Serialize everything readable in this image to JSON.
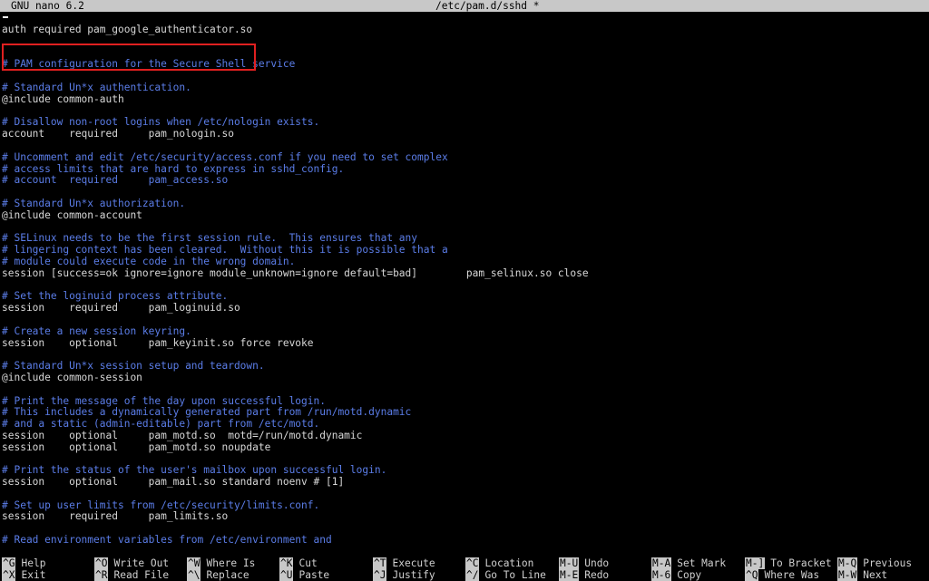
{
  "titlebar": {
    "app": "GNU nano 6.2",
    "file": "/etc/pam.d/sshd *"
  },
  "lines": [
    {
      "text": "auth required pam_google_authenticator.so",
      "type": "code"
    },
    {
      "text": "",
      "type": "code"
    },
    {
      "text": "",
      "type": "code"
    },
    {
      "text": "# PAM configuration for the Secure Shell service",
      "type": "comment"
    },
    {
      "text": "",
      "type": "code"
    },
    {
      "text": "# Standard Un*x authentication.",
      "type": "comment"
    },
    {
      "text": "@include common-auth",
      "type": "code"
    },
    {
      "text": "",
      "type": "code"
    },
    {
      "text": "# Disallow non-root logins when /etc/nologin exists.",
      "type": "comment"
    },
    {
      "text": "account    required     pam_nologin.so",
      "type": "code"
    },
    {
      "text": "",
      "type": "code"
    },
    {
      "text": "# Uncomment and edit /etc/security/access.conf if you need to set complex",
      "type": "comment"
    },
    {
      "text": "# access limits that are hard to express in sshd_config.",
      "type": "comment"
    },
    {
      "text": "# account  required     pam_access.so",
      "type": "comment"
    },
    {
      "text": "",
      "type": "code"
    },
    {
      "text": "# Standard Un*x authorization.",
      "type": "comment"
    },
    {
      "text": "@include common-account",
      "type": "code"
    },
    {
      "text": "",
      "type": "code"
    },
    {
      "text": "# SELinux needs to be the first session rule.  This ensures that any",
      "type": "comment"
    },
    {
      "text": "# lingering context has been cleared.  Without this it is possible that a",
      "type": "comment"
    },
    {
      "text": "# module could execute code in the wrong domain.",
      "type": "comment"
    },
    {
      "text": "session [success=ok ignore=ignore module_unknown=ignore default=bad]        pam_selinux.so close",
      "type": "code"
    },
    {
      "text": "",
      "type": "code"
    },
    {
      "text": "# Set the loginuid process attribute.",
      "type": "comment"
    },
    {
      "text": "session    required     pam_loginuid.so",
      "type": "code"
    },
    {
      "text": "",
      "type": "code"
    },
    {
      "text": "# Create a new session keyring.",
      "type": "comment"
    },
    {
      "text": "session    optional     pam_keyinit.so force revoke",
      "type": "code"
    },
    {
      "text": "",
      "type": "code"
    },
    {
      "text": "# Standard Un*x session setup and teardown.",
      "type": "comment"
    },
    {
      "text": "@include common-session",
      "type": "code"
    },
    {
      "text": "",
      "type": "code"
    },
    {
      "text": "# Print the message of the day upon successful login.",
      "type": "comment"
    },
    {
      "text": "# This includes a dynamically generated part from /run/motd.dynamic",
      "type": "comment"
    },
    {
      "text": "# and a static (admin-editable) part from /etc/motd.",
      "type": "comment"
    },
    {
      "text": "session    optional     pam_motd.so  motd=/run/motd.dynamic",
      "type": "code"
    },
    {
      "text": "session    optional     pam_motd.so noupdate",
      "type": "code"
    },
    {
      "text": "",
      "type": "code"
    },
    {
      "text": "# Print the status of the user's mailbox upon successful login.",
      "type": "comment"
    },
    {
      "text": "session    optional     pam_mail.so standard noenv # [1]",
      "type": "code"
    },
    {
      "text": "",
      "type": "code"
    },
    {
      "text": "# Set up user limits from /etc/security/limits.conf.",
      "type": "comment"
    },
    {
      "text": "session    required     pam_limits.so",
      "type": "code"
    },
    {
      "text": "",
      "type": "code"
    },
    {
      "text": "# Read environment variables from /etc/environment and",
      "type": "comment"
    }
  ],
  "shortcuts": [
    {
      "key": "^G",
      "label": "Help"
    },
    {
      "key": "^X",
      "label": "Exit"
    },
    {
      "key": "^O",
      "label": "Write Out"
    },
    {
      "key": "^R",
      "label": "Read File"
    },
    {
      "key": "^W",
      "label": "Where Is"
    },
    {
      "key": "^\\",
      "label": "Replace"
    },
    {
      "key": "^K",
      "label": "Cut"
    },
    {
      "key": "^U",
      "label": "Paste"
    },
    {
      "key": "^T",
      "label": "Execute"
    },
    {
      "key": "^J",
      "label": "Justify"
    },
    {
      "key": "^C",
      "label": "Location"
    },
    {
      "key": "^/",
      "label": "Go To Line"
    },
    {
      "key": "M-U",
      "label": "Undo"
    },
    {
      "key": "M-E",
      "label": "Redo"
    },
    {
      "key": "M-A",
      "label": "Set Mark"
    },
    {
      "key": "M-6",
      "label": "Copy"
    },
    {
      "key": "M-]",
      "label": "To Bracket"
    },
    {
      "key": "^Q",
      "label": "Where Was"
    },
    {
      "key": "M-Q",
      "label": "Previous"
    },
    {
      "key": "M-W",
      "label": "Next"
    }
  ],
  "colors": {
    "comment": "#5b7de8",
    "highlight_box": "#e02020",
    "titlebar_bg": "#c8c8c8"
  }
}
